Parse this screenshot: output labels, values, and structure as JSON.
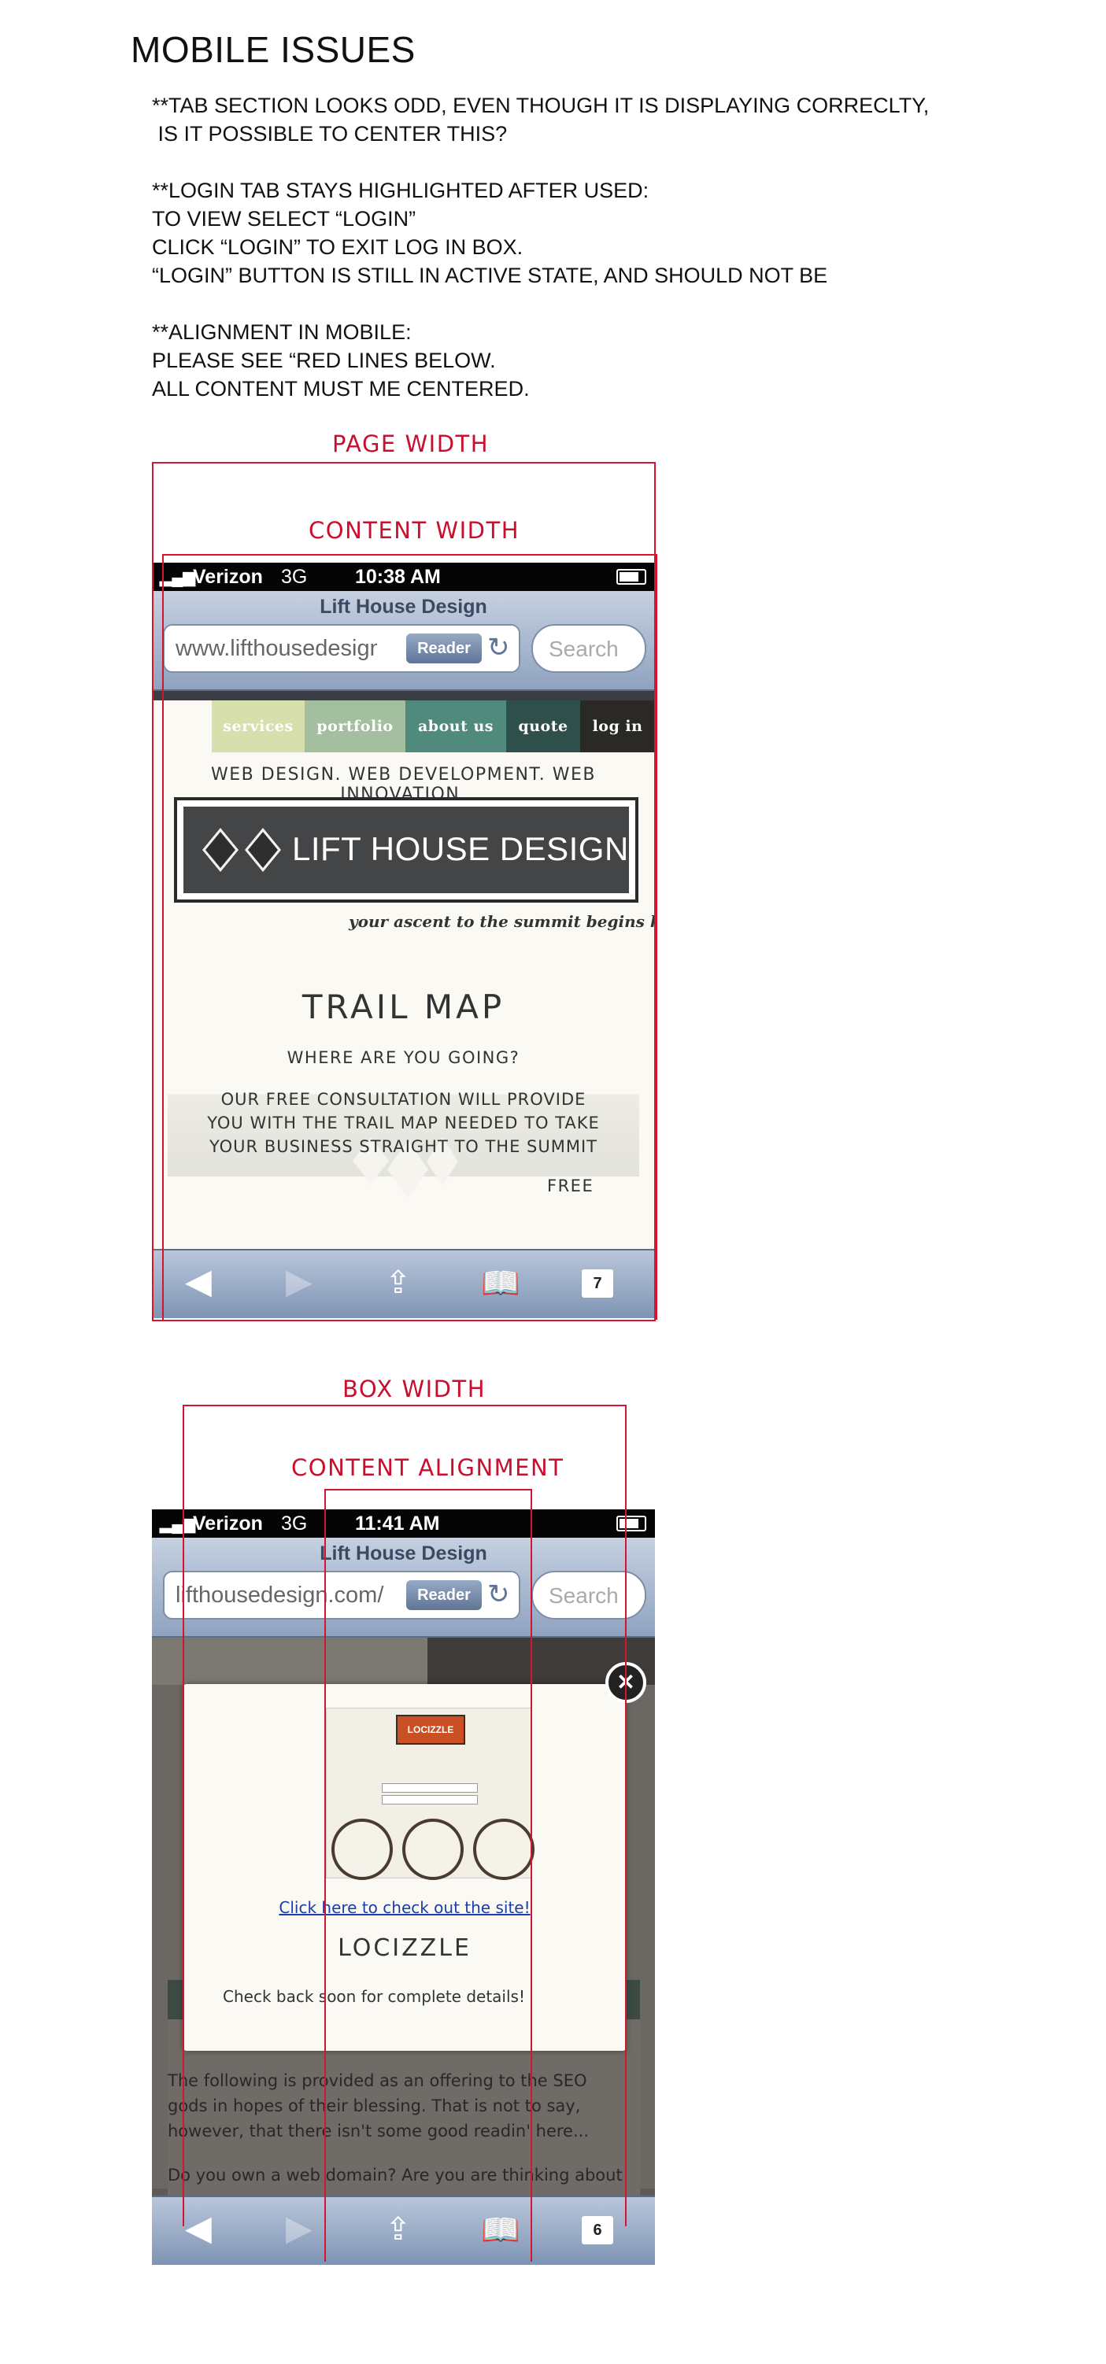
{
  "doc": {
    "heading": "MOBILE ISSUES",
    "issue1": "**TAB SECTION LOOKS ODD, EVEN THOUGH IT IS DISPLAYING CORRECLTY,\n IS IT POSSIBLE TO CENTER THIS?",
    "issue2": "**LOGIN TAB STAYS HIGHLIGHTED AFTER USED:\nTO VIEW SELECT “LOGIN”\nCLICK “LOGIN” TO EXIT LOG IN BOX.\n“LOGIN” BUTTON IS STILL IN ACTIVE STATE, AND SHOULD NOT BE",
    "issue3": "**ALIGNMENT IN MOBILE:\nPLEASE SEE “RED LINES BELOW.\nALL CONTENT MUST ME CENTERED."
  },
  "annotations": {
    "page_width": "PAGE WIDTH",
    "content_width": "CONTENT WIDTH",
    "box_width": "BOX WIDTH",
    "content_alignment": "CONTENT ALIGNMENT"
  },
  "colors": {
    "annotation": "#d4152f",
    "nav_services": "#d7dfad",
    "nav_portfolio": "#a4bf9f",
    "nav_about": "#4f8a7d",
    "nav_quote": "#2f4f4b",
    "nav_login": "#2b2926"
  },
  "screen1": {
    "status": {
      "carrier": "Verizon",
      "network": "3G",
      "time": "10:38 AM"
    },
    "safari": {
      "title": "Lift House Design",
      "url": "www.lifthousedesign.com",
      "reader": "Reader",
      "search_placeholder": "Search"
    },
    "nav": [
      "services",
      "portfolio",
      "about us",
      "quote",
      "log in"
    ],
    "tagline_top": "WEB DESIGN. WEB DEVELOPMENT. WEB INNOVATION.",
    "logo_text": "LIFT HOUSE DESIGN",
    "slogan": "your ascent to the summit begins here...",
    "section_title": "TRAIL MAP",
    "section_sub": "WHERE ARE YOU GOING?",
    "section_body": "OUR FREE CONSULTATION WILL PROVIDE\nYOU WITH THE TRAIL MAP NEEDED TO TAKE\nYOUR BUSINESS STRAIGHT TO THE SUMMIT",
    "free_label": "FREE",
    "tabs_count": "7"
  },
  "screen2": {
    "status": {
      "carrier": "Verizon",
      "network": "3G",
      "time": "11:41 AM"
    },
    "safari": {
      "title": "Lift House Design",
      "url": "lifthousedesign.com/",
      "reader": "Reader",
      "search_placeholder": "Search"
    },
    "modal": {
      "thumb_brand": "LOCIZZLE",
      "link": "Click here to check out the site!",
      "brand": "LOCIZZLE",
      "note": "Check back soon for complete details!"
    },
    "body_p1": "The following is provided as an offering to the SEO gods in hopes of their blessing. That is not to say, however, that there isn't some good readin' here...",
    "body_p2": "Do you own a web domain? Are you are thinking about",
    "tabs_count": "6"
  }
}
